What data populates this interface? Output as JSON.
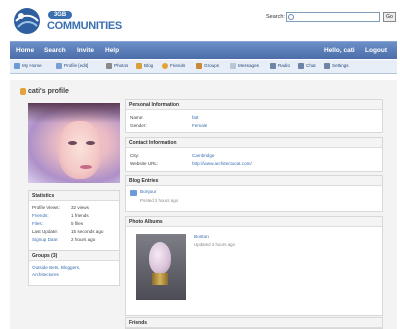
{
  "header": {
    "logo_badge": "3GB",
    "logo_text": "COMMUNITIES",
    "search_label": "Search:",
    "search_placeholder": "",
    "go_label": "Go"
  },
  "nav": {
    "items": [
      "Home",
      "Search",
      "Invite",
      "Help"
    ],
    "greeting": "Hello, cati",
    "logout": "Logout"
  },
  "subnav": {
    "items": [
      "My Home",
      "Profile [edit]",
      "Photos",
      "Blog",
      "Friends",
      "Groups",
      "Messages",
      "Radio",
      "Chat",
      "Settings"
    ]
  },
  "profile": {
    "title": "cati's profile"
  },
  "statistics": {
    "heading": "Statistics",
    "rows": [
      {
        "label": "Profile Views:",
        "value": "32 views"
      },
      {
        "label": "Friends:",
        "value": "1 friends"
      },
      {
        "label": "Files:",
        "value": "5 files"
      },
      {
        "label": "Last Update:",
        "value": "15 seconds ago"
      },
      {
        "label": "Signup Date:",
        "value": "2 hours ago"
      }
    ]
  },
  "groups": {
    "heading": "Groups (3)",
    "links_line1": "Outside Bets, Bloggers,",
    "links_line2": "Architectures"
  },
  "personal_info": {
    "heading": "Personal Information",
    "name_label": "Name:",
    "name_value": "fatt",
    "gender_label": "Gender:",
    "gender_value": "Female"
  },
  "contact_info": {
    "heading": "Contact Information",
    "city_label": "City:",
    "city_value": "Cambridge",
    "website_label": "Website URL:",
    "website_value": "http://www.architectucat.com/"
  },
  "blog": {
    "heading": "Blog Entries",
    "entry_title": "Bonjour",
    "entry_meta": "Posted 2 hours ago"
  },
  "albums": {
    "heading": "Photo Albums",
    "album_title": "Boston",
    "album_meta": "Updated 2 hours ago"
  },
  "friends": {
    "heading": "Friends"
  }
}
